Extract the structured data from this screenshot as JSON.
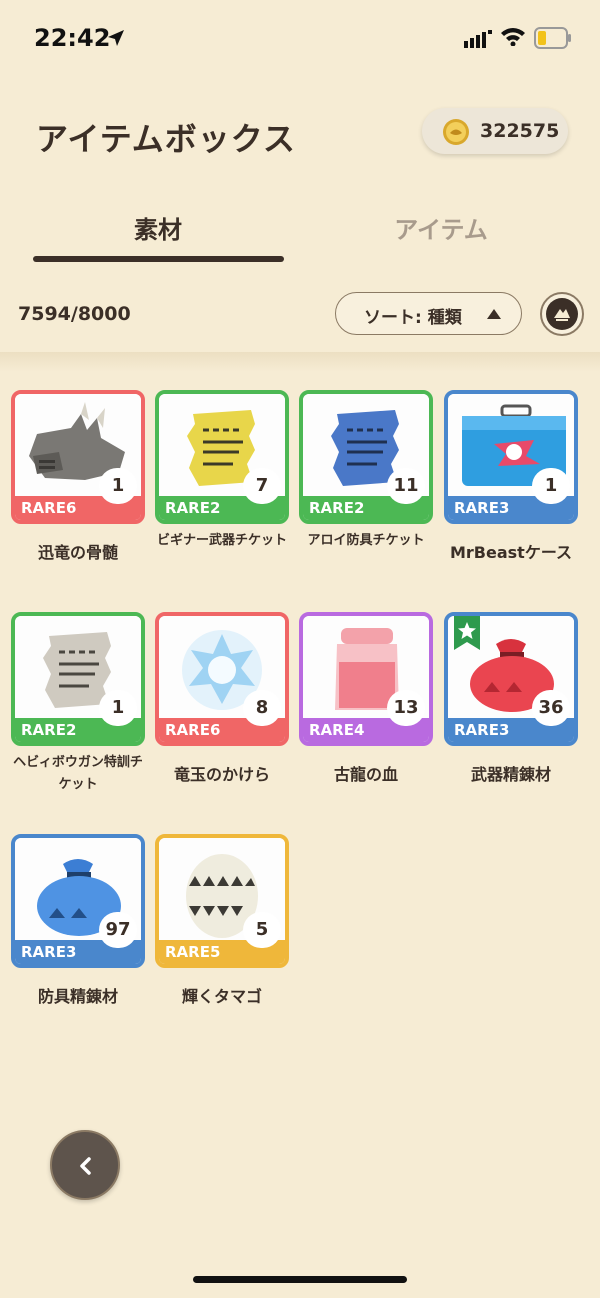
{
  "status": {
    "time": "22:42"
  },
  "header": {
    "title": "アイテムボックス",
    "coins": "322575"
  },
  "tabs": [
    {
      "label": "素材",
      "active": true
    },
    {
      "label": "アイテム",
      "active": false
    }
  ],
  "toolbar": {
    "capacity": "7594/8000",
    "sort_label": "ソート:  種類"
  },
  "colors": {
    "rare2": "#4cb854",
    "rare3": "#4a87cc",
    "rare4": "#b96ae0",
    "rare5": "#efb73a",
    "rare6": "#f06666"
  },
  "items": [
    {
      "name": "迅竜の骨髄",
      "rarity": "RARE6",
      "count": "1",
      "icon": "dragon-bone-icon"
    },
    {
      "name": "ビギナー武器チケット",
      "rarity": "RARE2",
      "count": "7",
      "icon": "yellow-ticket-icon"
    },
    {
      "name": "アロイ防具チケット",
      "rarity": "RARE2",
      "count": "11",
      "icon": "blue-ticket-icon"
    },
    {
      "name": "MrBeastケース",
      "rarity": "RARE3",
      "count": "1",
      "icon": "suitcase-icon"
    },
    {
      "name": "ヘビィボウガン特訓チケット",
      "rarity": "RARE2",
      "count": "1",
      "icon": "gray-ticket-icon"
    },
    {
      "name": "竜玉のかけら",
      "rarity": "RARE6",
      "count": "8",
      "icon": "dragon-gem-icon"
    },
    {
      "name": "古龍の血",
      "rarity": "RARE4",
      "count": "13",
      "icon": "blood-jar-icon"
    },
    {
      "name": "武器精錬材",
      "rarity": "RARE3",
      "count": "36",
      "icon": "red-pouch-icon"
    },
    {
      "name": "防具精錬材",
      "rarity": "RARE3",
      "count": "97",
      "icon": "blue-pouch-icon"
    },
    {
      "name": "輝くタマゴ",
      "rarity": "RARE5",
      "count": "5",
      "icon": "shining-egg-icon"
    }
  ]
}
